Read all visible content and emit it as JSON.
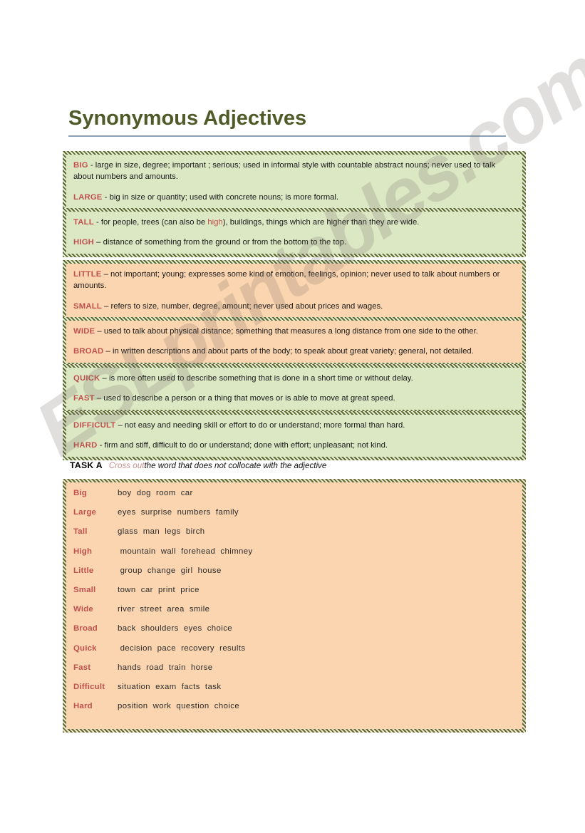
{
  "page": {
    "title": "Synonymous Adjectives",
    "watermark": "ESLprintables.com"
  },
  "colors": {
    "title": "#4f5a28",
    "keyword": "#c0504d",
    "green_panel": "#dce7c4",
    "peach_panel": "#fbd5b0",
    "border": "#5b6b2e",
    "rule": "#8ba0b4"
  },
  "definitions": [
    {
      "theme": "green",
      "lines": [
        {
          "keyword": "BIG",
          "text": " - large in size, degree; important ; serious; used in informal style with countable  abstract  nouns; never used  to talk about numbers and amounts."
        },
        {
          "keyword": "LARGE",
          "text": " - big in size or quantity; used with concrete nouns; is more formal."
        }
      ]
    },
    {
      "theme": "green",
      "lines": [
        {
          "keyword": "TALL",
          "text_before": " - for people, trees (can also be ",
          "inline_keyword": "high",
          "text_after": "), buildings, things which are higher than they are wide."
        },
        {
          "keyword": "HIGH",
          "text": " – distance of something from the ground or from the bottom to the top."
        }
      ]
    },
    {
      "theme": "peach",
      "lines": [
        {
          "keyword": "LITTLE",
          "text": " – not important; young; expresses some kind of emotion, feelings, opinion; never used to talk about  numbers or amounts."
        },
        {
          "keyword": "SMALL",
          "text": " – refers to size, number, degree, amount; never used about prices and wages."
        }
      ]
    },
    {
      "theme": "peach",
      "lines": [
        {
          "keyword": "WIDE",
          "text": "  – used to talk about physical distance; something that measures a long distance from one side to the other."
        },
        {
          "keyword": "BROAD",
          "text": "  –  in written descriptions and about parts of the body; to speak about great variety;  general, not detailed."
        }
      ]
    },
    {
      "theme": "green",
      "lines": [
        {
          "keyword": "QUICK",
          "text": " – is more often used to describe something that is done in a short time or without  delay."
        },
        {
          "keyword": "FAST",
          "text": " – used to describe a person or a thing that moves or is able to move at great speed."
        }
      ]
    },
    {
      "theme": "green",
      "lines": [
        {
          "keyword": "DIFFICULT",
          "text": " – not easy and needing skill or effort to do or understand; more formal than hard."
        },
        {
          "keyword": "HARD",
          "text": " - firm and stiff, difficult to do or understand; done with effort; unpleasant; not kind."
        }
      ]
    }
  ],
  "task_a": {
    "label": "TASK A",
    "emphasis": "Cross out",
    "rest": "the word that does not collocate with the adjective"
  },
  "task_rows": [
    {
      "adjective": "Big",
      "words": "boy  dog  room  car"
    },
    {
      "adjective": "Large",
      "words": "eyes  surprise  numbers  family"
    },
    {
      "adjective": "Tall",
      "words": "glass  man  legs  birch"
    },
    {
      "adjective": "High",
      "words": " mountain  wall  forehead  chimney"
    },
    {
      "adjective": "Little",
      "words": " group  change  girl  house"
    },
    {
      "adjective": "Small",
      "words": "town  car  print  price"
    },
    {
      "adjective": "Wide",
      "words": "river  street  area  smile"
    },
    {
      "adjective": "Broad",
      "words": "back  shoulders  eyes  choice"
    },
    {
      "adjective": "Quick",
      "words": " decision  pace  recovery  results"
    },
    {
      "adjective": "Fast",
      "words": "hands  road  train  horse"
    },
    {
      "adjective": "Difficult",
      "words": "situation  exam  facts  task"
    },
    {
      "adjective": "Hard",
      "words": "position  work  question  choice"
    }
  ]
}
